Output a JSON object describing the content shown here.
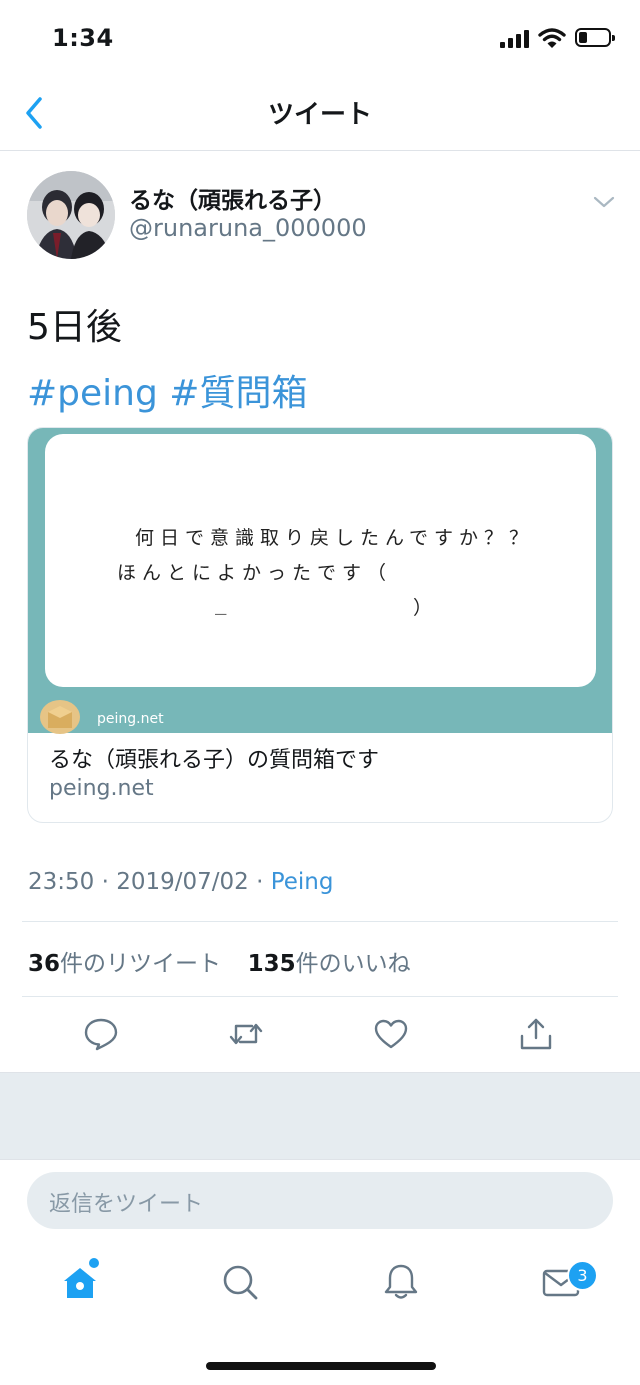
{
  "status_bar": {
    "time": "1:34"
  },
  "header": {
    "title": "ツイート"
  },
  "tweet": {
    "author_name": "るな（頑張れる子）",
    "handle": "@runaruna_000000",
    "text": "5日後",
    "hashtags": [
      "#peing",
      "#質問箱"
    ],
    "timestamp": "23:50 · 2019/07/02 · ",
    "source": "Peing"
  },
  "card": {
    "question_lines": [
      "何日で意識取り戻したんですか？？",
      "ほんとによかったです（"
    ],
    "question_line3_left": "_",
    "question_line3_right": "）",
    "image_domain": "peing.net",
    "title": "るな（頑張れる子）の質問箱です",
    "domain": "peing.net"
  },
  "stats": {
    "retweets": "36",
    "retweets_label": "件のリツイート",
    "likes": "135",
    "likes_label": "件のいいね"
  },
  "reply": {
    "placeholder": "返信をツイート"
  },
  "tabbar": {
    "messages_badge": "3"
  },
  "colors": {
    "accent": "#1da1f2",
    "link": "#3b94d9",
    "card_bg": "#77b7b8",
    "muted": "#657786"
  },
  "icons": [
    "back-chevron-icon",
    "caret-down-icon",
    "reply-icon",
    "retweet-icon",
    "like-icon",
    "share-icon",
    "home-icon",
    "search-icon",
    "notifications-icon",
    "messages-icon"
  ]
}
